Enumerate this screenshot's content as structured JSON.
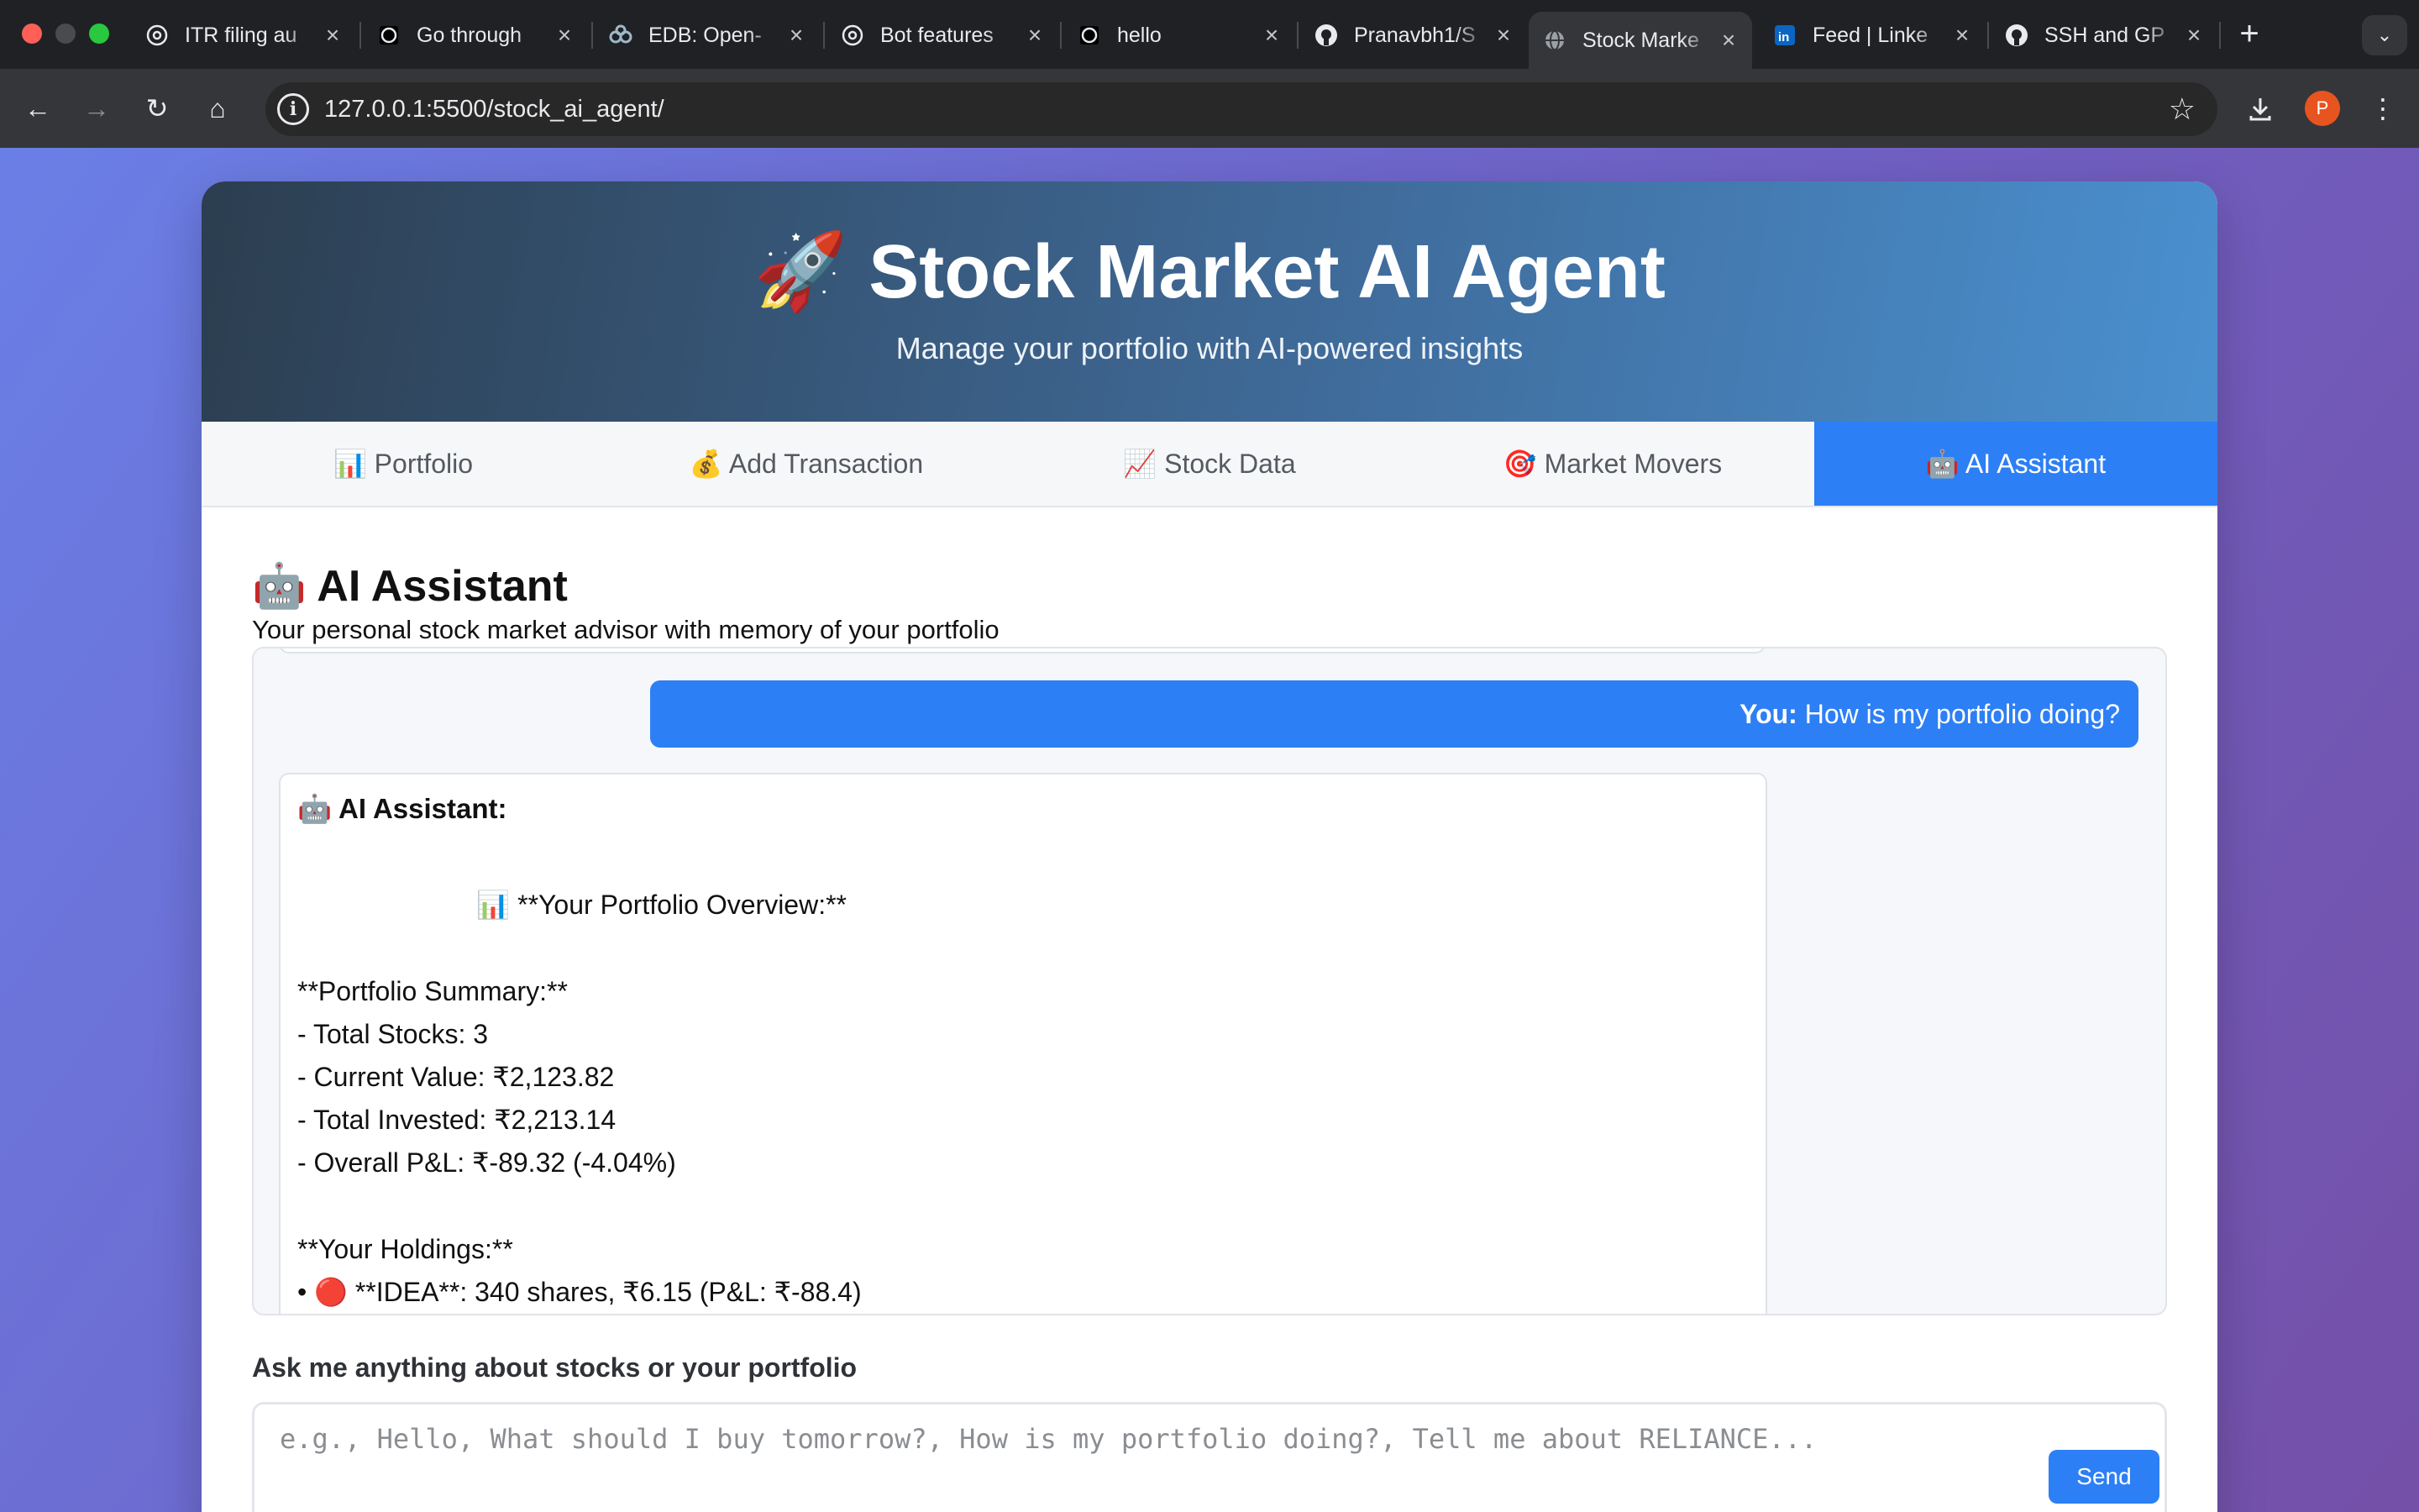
{
  "browser": {
    "tabs": [
      {
        "title": "ITR filing au",
        "icon": "openai-icon"
      },
      {
        "title": "Go through",
        "icon": "openai-icon"
      },
      {
        "title": "EDB: Open-",
        "icon": "edb-icon"
      },
      {
        "title": "Bot features",
        "icon": "openai-icon"
      },
      {
        "title": "hello",
        "icon": "openai-icon"
      },
      {
        "title": "Pranavbh1/S",
        "icon": "github-icon"
      },
      {
        "title": "Stock Marke",
        "icon": "globe-icon"
      },
      {
        "title": "Feed | Linke",
        "icon": "linkedin-icon"
      },
      {
        "title": "SSH and GP",
        "icon": "github-icon"
      }
    ],
    "url": "127.0.0.1:5500/stock_ai_agent/",
    "profile_initial": "P"
  },
  "header": {
    "title": "🚀 Stock Market AI Agent",
    "subtitle": "Manage your portfolio with AI-powered insights"
  },
  "nav_tabs": [
    {
      "label": "📊 Portfolio"
    },
    {
      "label": "💰 Add Transaction"
    },
    {
      "label": "📈 Stock Data"
    },
    {
      "label": "🎯 Market Movers"
    },
    {
      "label": "🤖 AI Assistant"
    }
  ],
  "assistant": {
    "title": "🤖 AI Assistant",
    "subtitle": "Your personal stock market advisor with memory of your portfolio",
    "user_message": {
      "label": "You:",
      "text": " How is my portfolio doing?"
    },
    "ai_message": {
      "label": "🤖 AI Assistant:",
      "body": "\n                        📊 **Your Portfolio Overview:**\n\n**Portfolio Summary:**\n- Total Stocks: 3\n- Current Value: ₹2,123.82\n- Total Invested: ₹2,213.14\n- Overall P&L: ₹-89.32 (-4.04%)\n\n**Your Holdings:**\n• 🔴 **IDEA**: 340 shares, ₹6.15 (P&L: ₹-88.4)"
    },
    "input_label": "Ask me anything about stocks or your portfolio",
    "input_placeholder": "e.g., Hello, What should I buy tomorrow?, How is my portfolio doing?, Tell me about RELIANCE...",
    "send_label": "Send"
  },
  "colors": {
    "accent": "#2d7ff5",
    "header_gradient_start": "#2c3e50",
    "header_gradient_end": "#4a90d0",
    "page_gradient_start": "#6a7fe6",
    "page_gradient_end": "#7450a8"
  }
}
